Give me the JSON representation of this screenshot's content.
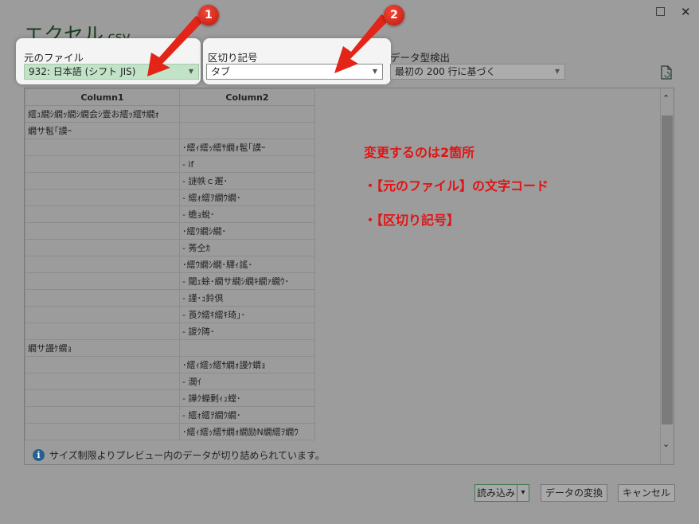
{
  "window": {
    "maximize_icon": "□",
    "close_icon": "✕",
    "title_name": "エクセル",
    "title_ext": ".csv"
  },
  "file_origin": {
    "label": "元のファイル",
    "value": "932: 日本語 (シフト JIS)"
  },
  "delimiter": {
    "label": "区切り記号",
    "value": "タブ"
  },
  "datatype": {
    "label": "データ型検出",
    "value": "最初の 200 行に基づく"
  },
  "preview": {
    "headers": [
      "Column1",
      "Column2"
    ],
    "rows": [
      [
        "繧ｭ繝ｼ繝ｯ繝ｼ繝会ｼ壹お繧ｯ繧ｻ繝ｫ",
        ""
      ],
      [
        "繝サ髢｢謨ｰ",
        ""
      ],
      [
        "",
        "･繧ｨ繧ｯ繧ｻ繝ｫ髢｢謨ｰ"
      ],
      [
        "",
        "- if"
      ],
      [
        "",
        "- 謎帙ｃ邂･"
      ],
      [
        "",
        "- 繧ｫ繧ｦ繝ｳ繝･"
      ],
      [
        "",
        "- 蟾ｮ蛻･"
      ],
      [
        "",
        "･繧ｳ繝ｼ繝･"
      ],
      [
        "",
        "- 莠仝ｶ"
      ],
      [
        "",
        "･繧ｳ繝ｼ繝･驛ｨ謠･"
      ],
      [
        "",
        "- 閾ｪ蜍･繝サ繝ｼ繝ｷ繝ｧ繝ｳ･"
      ],
      [
        "",
        "- 謹･ｭ鈴倶"
      ],
      [
        "",
        "- 莨ｸ繧ｷ繧ｷ琦｣･"
      ],
      [
        "",
        "- 謖ｸ陦･"
      ],
      [
        "繝サ謾ｹ蝟ｮ",
        ""
      ],
      [
        "",
        "･繧ｨ繧ｯ繧ｻ繝ｫ謾ｹ蝟ｮ"
      ],
      [
        "",
        "- 濶ｲ"
      ],
      [
        "",
        "- 譁ｸ蠑剰ｨｭ螳･"
      ],
      [
        "",
        "- 繧ｫ繧ｦ繝ｳ繝･"
      ],
      [
        "",
        "･繧ｨ繧ｯ繧ｻ繝ｫ繝励Ν繝繧ｦ繝ｳ"
      ]
    ],
    "info_icon": "i",
    "info_text": "サイズ制限よりプレビュー内のデータが切り詰められています。",
    "scroll_up_icon": "⌃",
    "scroll_down_icon": "⌄"
  },
  "annotations": {
    "line1": "変更するのは2箇所",
    "line2": "・【元のファイル】の文字コード",
    "line3": "・【区切り記号】",
    "badge1": "1",
    "badge2": "2"
  },
  "buttons": {
    "load": "読み込み",
    "load_dropdown_icon": "▾",
    "transform": "データの変換",
    "cancel": "キャンセル"
  },
  "colors": {
    "accent_green": "#217346",
    "annotation_red": "#e01414",
    "overlay_gray": "#9c9c9c"
  }
}
